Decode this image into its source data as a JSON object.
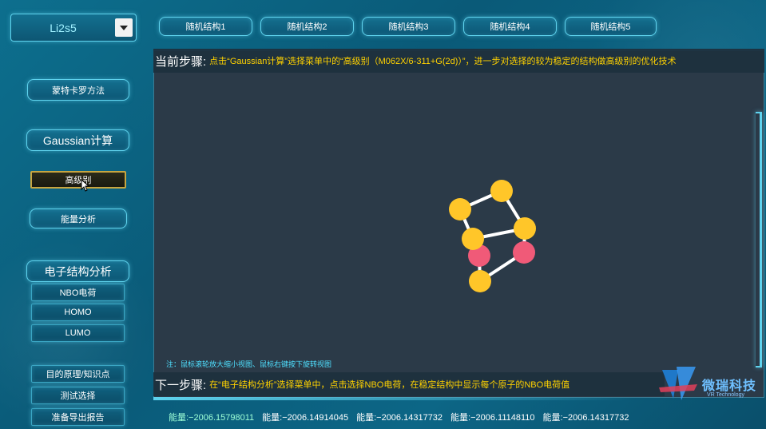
{
  "model_select": {
    "value": "Li2s5"
  },
  "top_tabs": [
    "随机结构1",
    "随机结构2",
    "随机结构3",
    "随机结构4",
    "随机结构5"
  ],
  "sidebar": {
    "monte_carlo": "蒙特卡罗方法",
    "gaussian": "Gaussian计算",
    "high_level": "高级别",
    "energy_analysis": "能量分析",
    "electronic": "电子结构分析",
    "nbo": "NBO电荷",
    "homo": "HOMO",
    "lumo": "LUMO",
    "purpose": "目的原理/知识点",
    "test": "测试选择",
    "report": "准备导出报告"
  },
  "current_step": {
    "label": "当前步骤:",
    "text": "点击“Gaussian计算”选择菜单中的“高级别（M062X/6-311+G(2d)）”，进一步对选择的较为稳定的结构做高级别的优化技术"
  },
  "next_step": {
    "label": "下一步骤:",
    "text": "在“电子结构分析”选择菜单中，点击选择NBO电荷，在稳定结构中显示每个原子的NBO电荷值"
  },
  "hint": "注：鼠标滚轮放大缩小视图、鼠标右键按下旋转视图",
  "energies": [
    "能量:−2006.15798011",
    "能量:−2006.14914045",
    "能量:−2006.14317732",
    "能量:−2006.11148110",
    "能量:−2006.14317732"
  ],
  "logo": {
    "cn": "微瑞科技",
    "en": "VR Technology"
  },
  "colors": {
    "sulfur": "#ffc629",
    "lithium": "#f05a78",
    "accent": "#5fd3ee",
    "step_text": "#ffd200"
  }
}
